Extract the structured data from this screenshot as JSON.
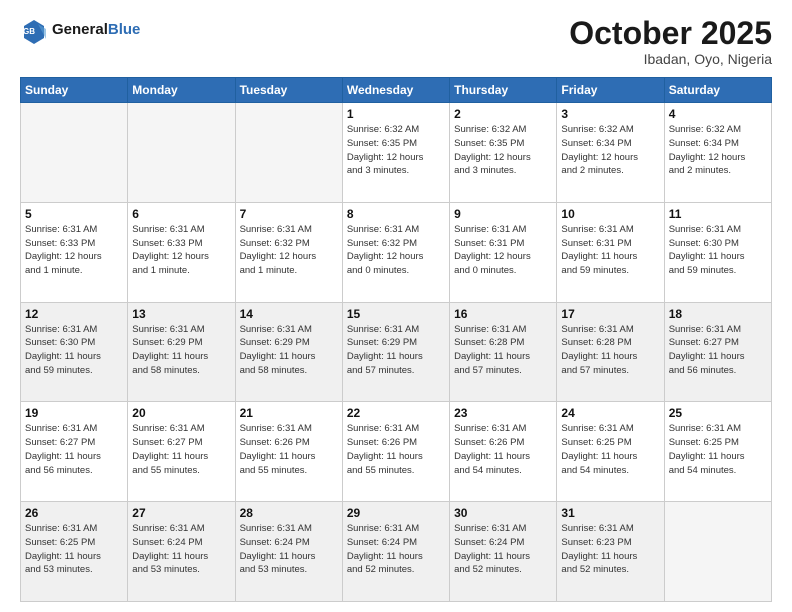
{
  "header": {
    "logo_line1": "General",
    "logo_line2": "Blue",
    "month": "October 2025",
    "location": "Ibadan, Oyo, Nigeria"
  },
  "weekdays": [
    "Sunday",
    "Monday",
    "Tuesday",
    "Wednesday",
    "Thursday",
    "Friday",
    "Saturday"
  ],
  "weeks": [
    [
      {
        "day": "",
        "info": "",
        "empty": true
      },
      {
        "day": "",
        "info": "",
        "empty": true
      },
      {
        "day": "",
        "info": "",
        "empty": true
      },
      {
        "day": "1",
        "info": "Sunrise: 6:32 AM\nSunset: 6:35 PM\nDaylight: 12 hours\nand 3 minutes."
      },
      {
        "day": "2",
        "info": "Sunrise: 6:32 AM\nSunset: 6:35 PM\nDaylight: 12 hours\nand 3 minutes."
      },
      {
        "day": "3",
        "info": "Sunrise: 6:32 AM\nSunset: 6:34 PM\nDaylight: 12 hours\nand 2 minutes."
      },
      {
        "day": "4",
        "info": "Sunrise: 6:32 AM\nSunset: 6:34 PM\nDaylight: 12 hours\nand 2 minutes."
      }
    ],
    [
      {
        "day": "5",
        "info": "Sunrise: 6:31 AM\nSunset: 6:33 PM\nDaylight: 12 hours\nand 1 minute."
      },
      {
        "day": "6",
        "info": "Sunrise: 6:31 AM\nSunset: 6:33 PM\nDaylight: 12 hours\nand 1 minute."
      },
      {
        "day": "7",
        "info": "Sunrise: 6:31 AM\nSunset: 6:32 PM\nDaylight: 12 hours\nand 1 minute."
      },
      {
        "day": "8",
        "info": "Sunrise: 6:31 AM\nSunset: 6:32 PM\nDaylight: 12 hours\nand 0 minutes."
      },
      {
        "day": "9",
        "info": "Sunrise: 6:31 AM\nSunset: 6:31 PM\nDaylight: 12 hours\nand 0 minutes."
      },
      {
        "day": "10",
        "info": "Sunrise: 6:31 AM\nSunset: 6:31 PM\nDaylight: 11 hours\nand 59 minutes."
      },
      {
        "day": "11",
        "info": "Sunrise: 6:31 AM\nSunset: 6:30 PM\nDaylight: 11 hours\nand 59 minutes."
      }
    ],
    [
      {
        "day": "12",
        "info": "Sunrise: 6:31 AM\nSunset: 6:30 PM\nDaylight: 11 hours\nand 59 minutes."
      },
      {
        "day": "13",
        "info": "Sunrise: 6:31 AM\nSunset: 6:29 PM\nDaylight: 11 hours\nand 58 minutes."
      },
      {
        "day": "14",
        "info": "Sunrise: 6:31 AM\nSunset: 6:29 PM\nDaylight: 11 hours\nand 58 minutes."
      },
      {
        "day": "15",
        "info": "Sunrise: 6:31 AM\nSunset: 6:29 PM\nDaylight: 11 hours\nand 57 minutes."
      },
      {
        "day": "16",
        "info": "Sunrise: 6:31 AM\nSunset: 6:28 PM\nDaylight: 11 hours\nand 57 minutes."
      },
      {
        "day": "17",
        "info": "Sunrise: 6:31 AM\nSunset: 6:28 PM\nDaylight: 11 hours\nand 57 minutes."
      },
      {
        "day": "18",
        "info": "Sunrise: 6:31 AM\nSunset: 6:27 PM\nDaylight: 11 hours\nand 56 minutes."
      }
    ],
    [
      {
        "day": "19",
        "info": "Sunrise: 6:31 AM\nSunset: 6:27 PM\nDaylight: 11 hours\nand 56 minutes."
      },
      {
        "day": "20",
        "info": "Sunrise: 6:31 AM\nSunset: 6:27 PM\nDaylight: 11 hours\nand 55 minutes."
      },
      {
        "day": "21",
        "info": "Sunrise: 6:31 AM\nSunset: 6:26 PM\nDaylight: 11 hours\nand 55 minutes."
      },
      {
        "day": "22",
        "info": "Sunrise: 6:31 AM\nSunset: 6:26 PM\nDaylight: 11 hours\nand 55 minutes."
      },
      {
        "day": "23",
        "info": "Sunrise: 6:31 AM\nSunset: 6:26 PM\nDaylight: 11 hours\nand 54 minutes."
      },
      {
        "day": "24",
        "info": "Sunrise: 6:31 AM\nSunset: 6:25 PM\nDaylight: 11 hours\nand 54 minutes."
      },
      {
        "day": "25",
        "info": "Sunrise: 6:31 AM\nSunset: 6:25 PM\nDaylight: 11 hours\nand 54 minutes."
      }
    ],
    [
      {
        "day": "26",
        "info": "Sunrise: 6:31 AM\nSunset: 6:25 PM\nDaylight: 11 hours\nand 53 minutes."
      },
      {
        "day": "27",
        "info": "Sunrise: 6:31 AM\nSunset: 6:24 PM\nDaylight: 11 hours\nand 53 minutes."
      },
      {
        "day": "28",
        "info": "Sunrise: 6:31 AM\nSunset: 6:24 PM\nDaylight: 11 hours\nand 53 minutes."
      },
      {
        "day": "29",
        "info": "Sunrise: 6:31 AM\nSunset: 6:24 PM\nDaylight: 11 hours\nand 52 minutes."
      },
      {
        "day": "30",
        "info": "Sunrise: 6:31 AM\nSunset: 6:24 PM\nDaylight: 11 hours\nand 52 minutes."
      },
      {
        "day": "31",
        "info": "Sunrise: 6:31 AM\nSunset: 6:23 PM\nDaylight: 11 hours\nand 52 minutes."
      },
      {
        "day": "",
        "info": "",
        "empty": true
      }
    ]
  ]
}
